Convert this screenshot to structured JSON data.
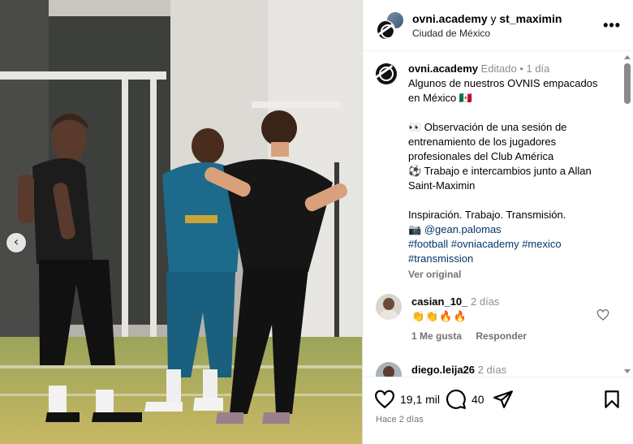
{
  "header": {
    "account_primary": "ovni.academy",
    "connector": " y ",
    "account_secondary": "st_maximin",
    "location": "Ciudad de México",
    "more_icon": "more-horizontal-icon"
  },
  "caption": {
    "username": "ovni.academy",
    "meta": " Editado • 1 día",
    "lines": [
      "Algunos de nuestros OVNIS empacados",
      "en México 🇲🇽",
      "",
      "👀 Observación de una sesión de",
      "entrenamiento de los jugadores",
      "profesionales del Club América",
      "⚽ Trabajo e intercambios junto a Allan",
      "Saint-Maximin",
      "",
      "Inspiración. Trabajo. Transmisión."
    ],
    "mention_prefix": "📷 ",
    "mention": "@gean.palomas",
    "hashtags_line1": "#football #ovniacademy #mexico",
    "hashtags_line2": "#transmission",
    "see_original": "Ver original"
  },
  "comments": [
    {
      "username": "casian_10_",
      "time": " 2 días",
      "text": "👏👏🔥🔥",
      "likes_label": "1 Me gusta",
      "reply_label": "Responder"
    },
    {
      "username": "diego.leija26",
      "time": " 2 días"
    }
  ],
  "footer": {
    "likes_count": "19,1 mil",
    "comments_count": "40",
    "time_ago": "Hace 2 días"
  },
  "colors": {
    "link": "#00376b",
    "muted": "#737373",
    "border": "#dbdbdb"
  }
}
